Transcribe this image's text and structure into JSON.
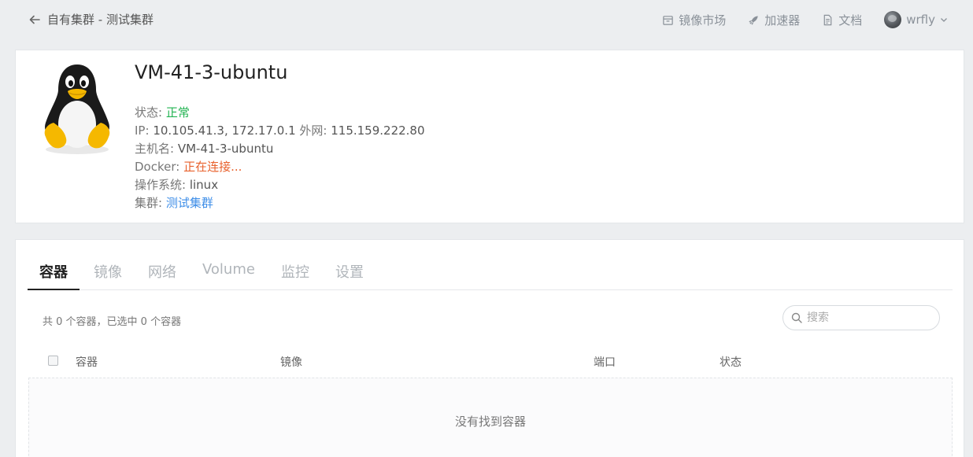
{
  "header": {
    "breadcrumb": "自有集群 - 测试集群",
    "nav": {
      "image_market": "镜像市场",
      "accelerator": "加速器",
      "docs": "文档"
    },
    "user": "wrfly"
  },
  "host": {
    "name": "VM-41-3-ubuntu",
    "status_label": "状态:",
    "status_value": "正常",
    "ip_label": "IP:",
    "ip_value": "10.105.41.3, 172.17.0.1",
    "public_label": "外网:",
    "public_value": "115.159.222.80",
    "hostname_label": "主机名:",
    "hostname_value": "VM-41-3-ubuntu",
    "docker_label": "Docker:",
    "docker_value": "正在连接...",
    "os_label": "操作系统:",
    "os_value": "linux",
    "cluster_label": "集群:",
    "cluster_value": "测试集群"
  },
  "tabs": [
    "容器",
    "镜像",
    "网络",
    "Volume",
    "监控",
    "设置"
  ],
  "active_tab": "容器",
  "containers": {
    "summary": "共 0 个容器，已选中 0 个容器",
    "search_placeholder": "搜索",
    "columns": [
      "容器",
      "镜像",
      "端口",
      "状态"
    ],
    "empty_text": "没有找到容器"
  },
  "colors": {
    "ok": "#21b351",
    "warn": "#e8612c",
    "link": "#3e8ee8"
  }
}
